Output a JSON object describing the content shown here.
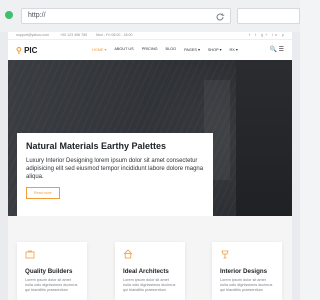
{
  "browser": {
    "url": "http://"
  },
  "topbar": {
    "email": "support@yahoo.com",
    "phone": "+00 123 456 789",
    "hours": "Mon - Fri 08:00 - 18:00",
    "social": "f t g+ in p"
  },
  "nav": {
    "logo_text": "PIC",
    "items": [
      "HOME ▾",
      "ABOUT US",
      "PRICING",
      "BLOG",
      "PAGES ▾",
      "SHOP ▾",
      "RX ▾"
    ],
    "icons": "🔍 ☰"
  },
  "hero": {
    "title": "Natural Materials Earthy Palettes",
    "description": "Luxury Interior Designing lorem ipsum dolor sit amet consectetur adipisicing elit sed eiusmod tempor incididunt labore dolore magna aliqua.",
    "button_label": "Read more"
  },
  "features": [
    {
      "title": "Quality Builders",
      "text": "Lorem ipsum dolor sit amet nulla odio dignissimos ducimus qui blanditiis praesentium"
    },
    {
      "title": "Ideal Architects",
      "text": "Lorem ipsum dolor sit amet nulla odio dignissimos ducimus qui blanditiis praesentium"
    },
    {
      "title": "Interior Designs",
      "text": "Lorem ipsum dolor sit amet nulla odio dignissimos ducimus qui blanditiis praesentium"
    }
  ],
  "colors": {
    "accent": "#f29b38",
    "window_dot": "#3fbf6f"
  }
}
